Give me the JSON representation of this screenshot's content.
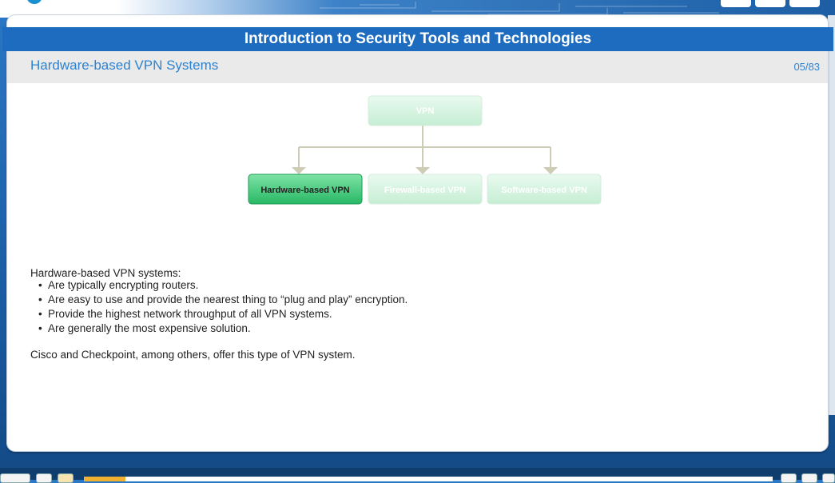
{
  "window": {
    "title": "Introduction to Security Tools and Technologies",
    "subtitle": "Hardware-based VPN Systems",
    "page_indicator": "05/83"
  },
  "diagram": {
    "root": "VPN",
    "children": [
      "Hardware-based VPN",
      "Firewall-based VPN",
      "Software-based VPN"
    ],
    "highlighted": "Hardware-based VPN",
    "colors": {
      "highlight": "#2ec26e",
      "inactive": "#c9f0d6",
      "connector": "#cfccb5"
    }
  },
  "content": {
    "intro": "Hardware-based VPN systems:",
    "bullets": [
      "Are typically encrypting routers.",
      "Are easy to use and provide the nearest thing to “plug and play” encryption.",
      "Provide the highest network throughput of all VPN systems.",
      "Are generally the most expensive solution."
    ],
    "closing": "Cisco and Checkpoint, among others, offer this type of VPN system."
  },
  "progress": {
    "fraction": 0.0602
  },
  "colors": {
    "accent": "#1d6cbf",
    "subtitle": "#2f82d0",
    "progress": "#f0b030"
  }
}
